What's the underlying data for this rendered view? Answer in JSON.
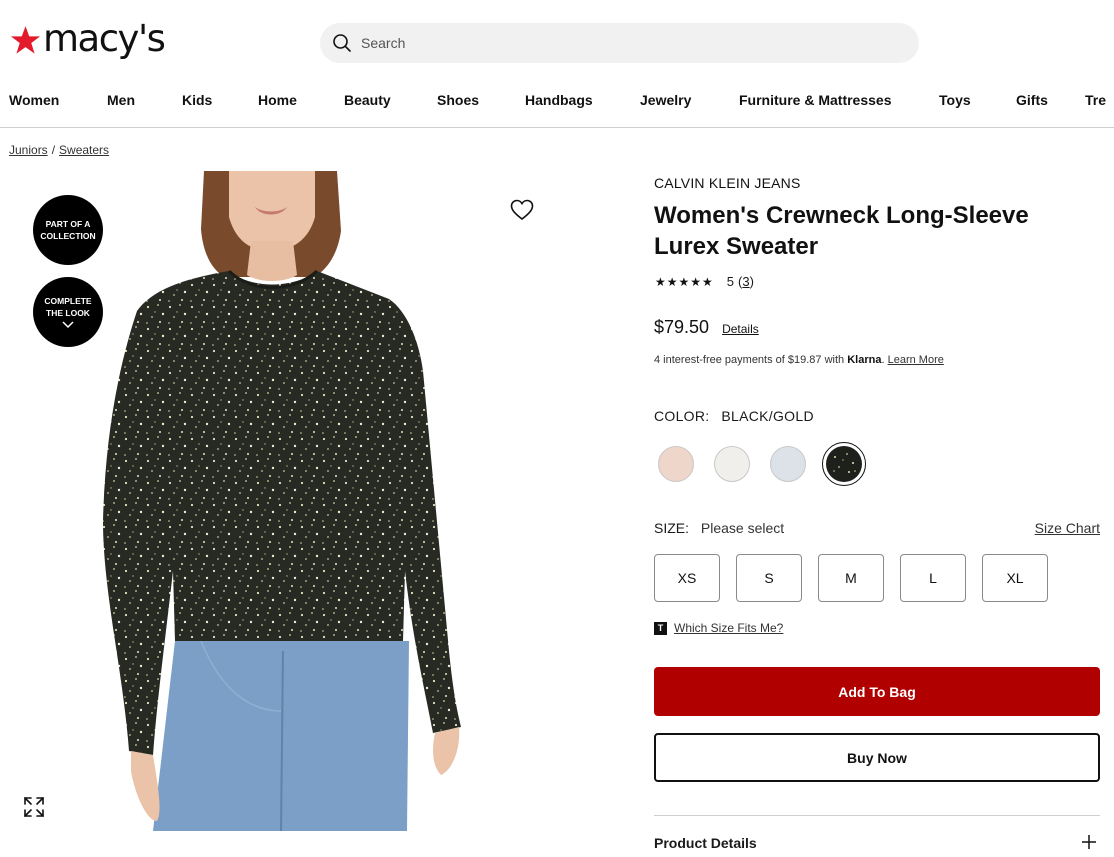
{
  "header": {
    "logo_text": "macy's",
    "search_placeholder": "Search",
    "nav": [
      "Women",
      "Men",
      "Kids",
      "Home",
      "Beauty",
      "Shoes",
      "Handbags",
      "Jewelry",
      "Furniture & Mattresses",
      "Toys",
      "Gifts",
      "Tre"
    ]
  },
  "breadcrumb": [
    "Juniors",
    "Sweaters"
  ],
  "badges": {
    "collection_line1": "PART OF A",
    "collection_line2": "COLLECTION",
    "look_line1": "COMPLETE",
    "look_line2": "THE LOOK"
  },
  "product": {
    "brand": "CALVIN KLEIN JEANS",
    "title": "Women's Crewneck Long-Sleeve Lurex Sweater",
    "stars": "★★★★★",
    "rating": "5",
    "review_count": "3",
    "price": "$79.50",
    "details_link": "Details",
    "klarna_text": "4 interest-free payments of $19.87 with",
    "klarna_brand": "Klarna",
    "klarna_learn": "Learn More",
    "color_label": "COLOR:",
    "color_value": "BLACK/GOLD",
    "swatches": [
      {
        "name": "blush",
        "color": "#efd6cb"
      },
      {
        "name": "ivory",
        "color": "#f1efeb"
      },
      {
        "name": "light-blue",
        "color": "#dde2e8"
      },
      {
        "name": "black-gold",
        "color": "#1e201c"
      }
    ],
    "size_label": "SIZE:",
    "size_value": "Please select",
    "size_chart": "Size Chart",
    "sizes": [
      "XS",
      "S",
      "M",
      "L",
      "XL"
    ],
    "fit_icon": "T",
    "fit_text": "Which Size Fits Me?",
    "add_to_bag": "Add To Bag",
    "buy_now": "Buy Now",
    "product_details": "Product Details"
  },
  "colors": {
    "brand_red": "#e21a2c",
    "button_red": "#b00000"
  }
}
